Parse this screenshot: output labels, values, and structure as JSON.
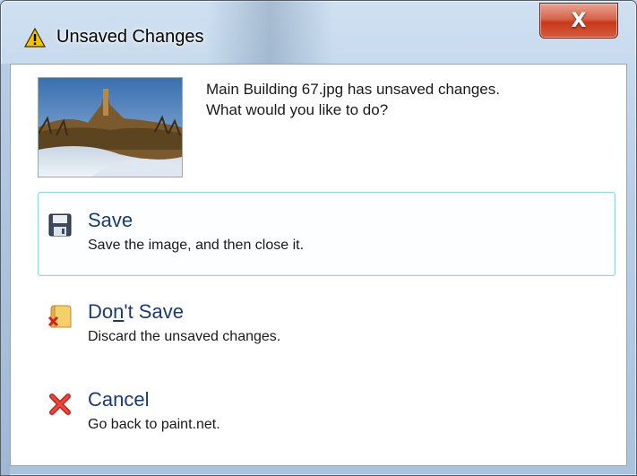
{
  "window": {
    "title": "Unsaved Changes",
    "close_glyph": "X"
  },
  "message": {
    "line1": "Main Building 67.jpg has unsaved changes.",
    "line2": "What would you like to do?"
  },
  "options": [
    {
      "title": "Save",
      "description": "Save the image, and then close it.",
      "icon": "floppy-disk-icon",
      "selected": true
    },
    {
      "title_pre": "Do",
      "title_mnemonic": "n",
      "title_post": "'t Save",
      "description": "Discard the unsaved changes.",
      "icon": "discard-document-icon",
      "selected": false
    },
    {
      "title": "Cancel",
      "description": "Go back to paint.net.",
      "icon": "red-x-icon",
      "selected": false
    }
  ],
  "colors": {
    "option_title": "#1a3a7a",
    "selected_border": "#8fd3ef",
    "close_button": "#c8391c"
  }
}
